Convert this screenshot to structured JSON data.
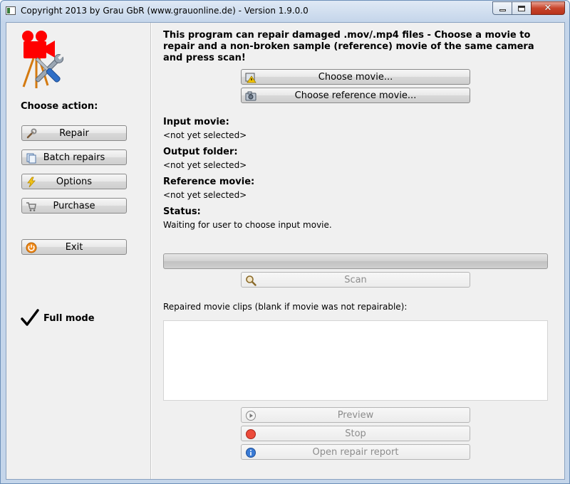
{
  "window": {
    "title": "Copyright 2013 by Grau GbR (www.grauonline.de) - Version 1.9.0.0",
    "close_glyph": "✕"
  },
  "sidebar": {
    "heading": "Choose action:",
    "buttons": [
      {
        "label": "Repair",
        "icon": "wrench-icon"
      },
      {
        "label": "Batch repairs",
        "icon": "documents-icon"
      },
      {
        "label": "Options",
        "icon": "lightning-icon"
      },
      {
        "label": "Purchase",
        "icon": "shopping-cart-icon"
      }
    ],
    "exit_label": "Exit",
    "mode_label": "Full mode"
  },
  "main": {
    "intro": "This program can repair damaged .mov/.mp4 files - Choose a movie to repair and a non-broken sample (reference) movie of the same camera and press scan!",
    "choose_movie_label": "Choose movie...",
    "choose_reference_label": "Choose reference movie...",
    "fields": {
      "input_label": "Input movie:",
      "input_value": "<not yet selected>",
      "output_label": "Output folder:",
      "output_value": "<not yet selected>",
      "reference_label": "Reference movie:",
      "reference_value": "<not yet selected>",
      "status_label": "Status:",
      "status_value": "Waiting for user to choose input movie."
    },
    "progress": 0,
    "scan_label": "Scan",
    "clips_label": "Repaired movie clips (blank if movie was not repairable):",
    "clips": [],
    "preview_label": "Preview",
    "stop_label": "Stop",
    "report_label": "Open repair report"
  },
  "colors": {
    "window_frame": "#c4d5ea",
    "client_bg": "#f0f0f0",
    "close_button": "#c8452b",
    "logo_red": "#ff0000"
  }
}
